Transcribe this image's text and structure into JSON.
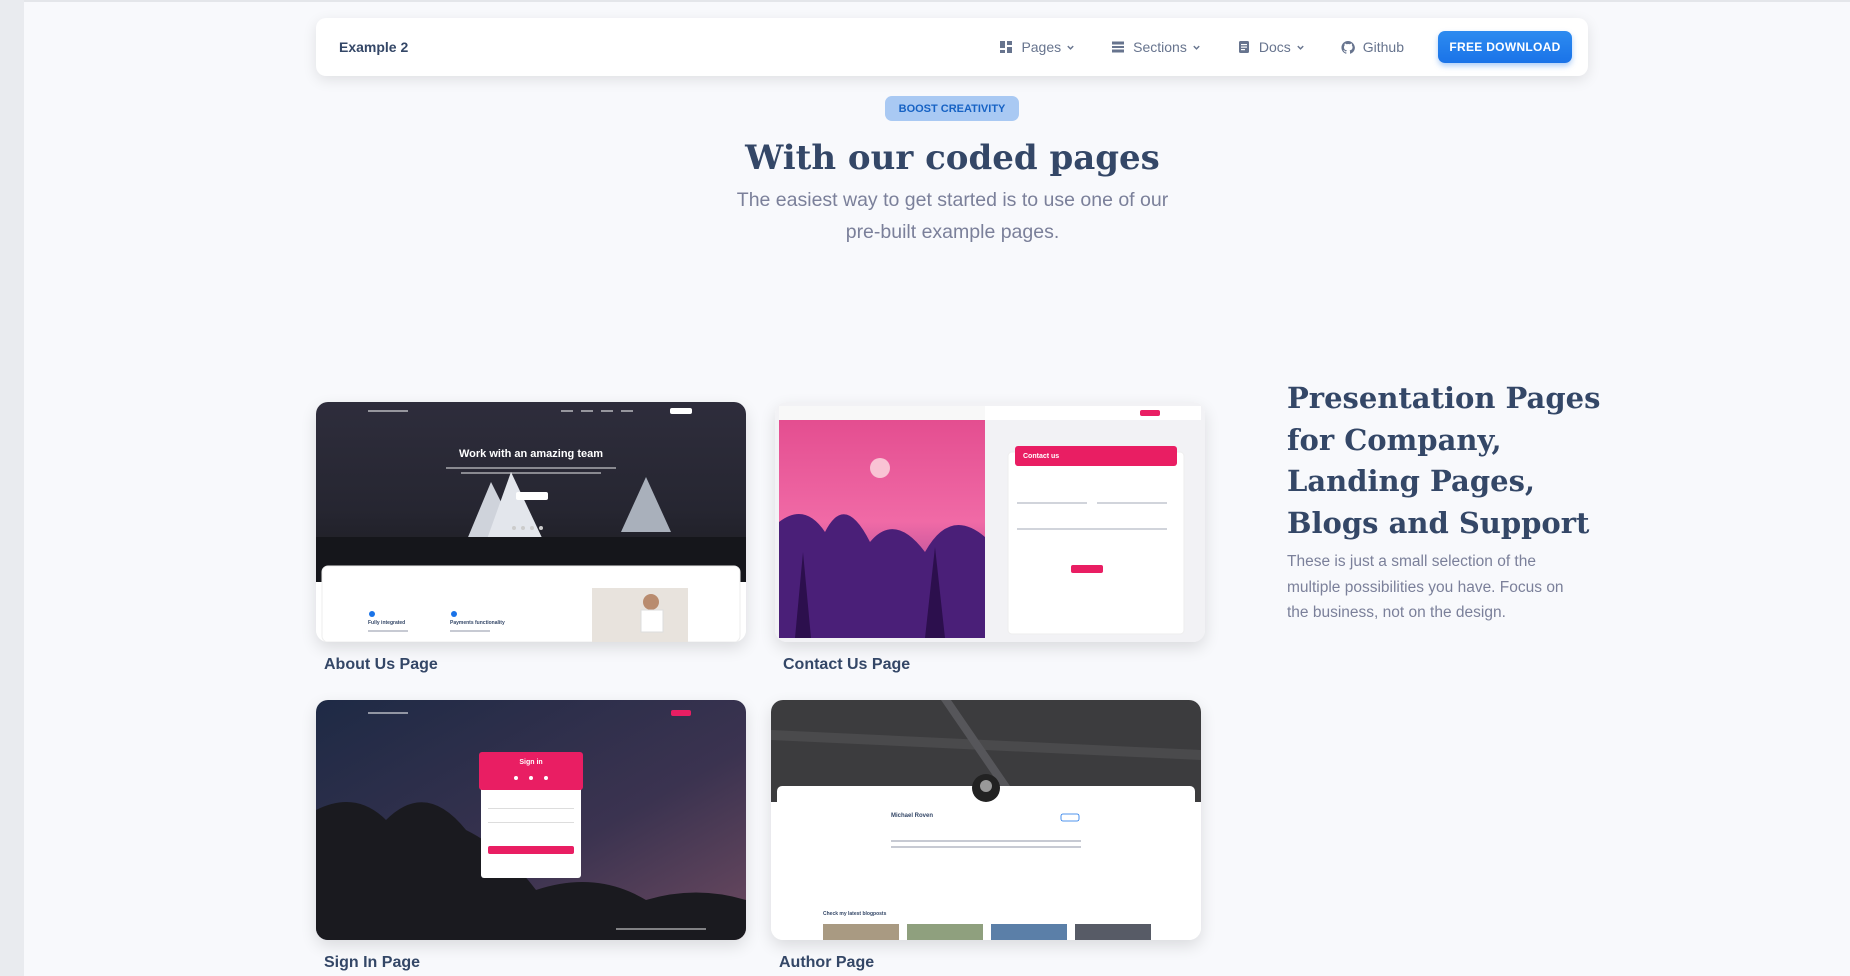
{
  "navbar": {
    "brand": "Example 2",
    "links": [
      {
        "label": "Pages",
        "icon": "dashboard-icon"
      },
      {
        "label": "Sections",
        "icon": "sections-icon"
      },
      {
        "label": "Docs",
        "icon": "docs-icon"
      },
      {
        "label": "Github",
        "icon": "github-icon"
      }
    ],
    "download_label": "FREE DOWNLOAD"
  },
  "hero": {
    "badge": "BOOST CREATIVITY",
    "title": "With our coded pages",
    "subtitle": "The easiest way to get started is to use one of our pre-built example pages."
  },
  "cards": [
    {
      "label": "About Us Page",
      "thumb_heading": "Work with an amazing team",
      "thumb_features": [
        "Fully integrated",
        "Payments functionality"
      ]
    },
    {
      "label": "Contact Us Page",
      "thumb_heading": "Contact us"
    },
    {
      "label": "Sign In Page",
      "thumb_heading": "Sign in"
    },
    {
      "label": "Author Page",
      "thumb_heading": "Michael Roven",
      "thumb_subheading": "Check my latest blogposts"
    }
  ],
  "side": {
    "title": "Presentation Pages for Company, Landing Pages, Blogs and Support",
    "description": "These is just a small selection of the multiple possibilities you have. Focus on the business, not on the design."
  },
  "colors": {
    "accent": "#1a73e8",
    "badge_bg": "#a9c9f3",
    "pink": "#e91e63",
    "text": "#344767",
    "muted": "#7b809a"
  }
}
